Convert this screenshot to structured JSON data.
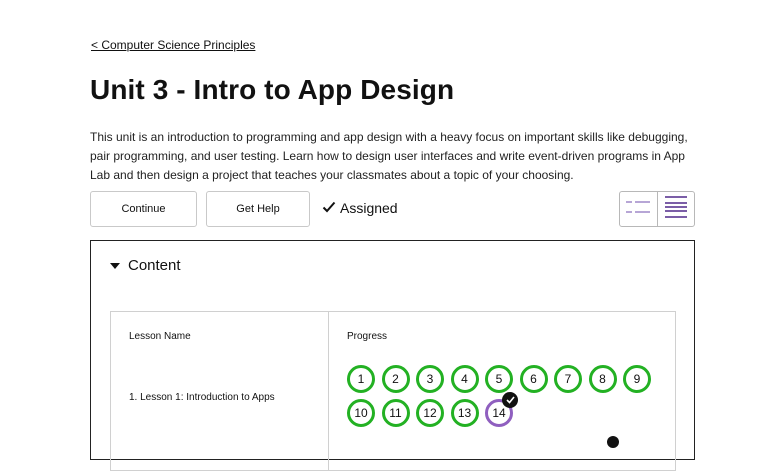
{
  "breadcrumb": {
    "back_label": "< Computer Science Principles"
  },
  "unit": {
    "title": "Unit 3 - Intro to App Design",
    "description": "This unit is an introduction to programming and app design with a heavy focus on important skills like debugging, pair programming, and user testing. Learn how to design user interfaces and write event-driven programs in App Lab and then design a project that teaches your classmates about a topic of your choosing."
  },
  "actions": {
    "continue_label": "Continue",
    "help_label": "Get Help",
    "assigned_label": "Assigned"
  },
  "view_toggle": {
    "options": [
      "list-view-icon",
      "detail-view-icon"
    ],
    "selected": "detail-view-icon"
  },
  "content": {
    "header": "Content",
    "columns": [
      "Lesson Name",
      "Progress"
    ],
    "lessons": [
      {
        "name": "1. Lesson 1: Introduction to Apps",
        "bubbles": [
          "1",
          "2",
          "3",
          "4",
          "5",
          "6",
          "7",
          "8",
          "9",
          "10",
          "11",
          "12",
          "13",
          "14"
        ],
        "assessment_bubble": "14"
      }
    ]
  },
  "colors": {
    "completed": "#23b123",
    "assessment": "#8f5fbf",
    "text": "#111111",
    "border": "#d0d0d0"
  }
}
